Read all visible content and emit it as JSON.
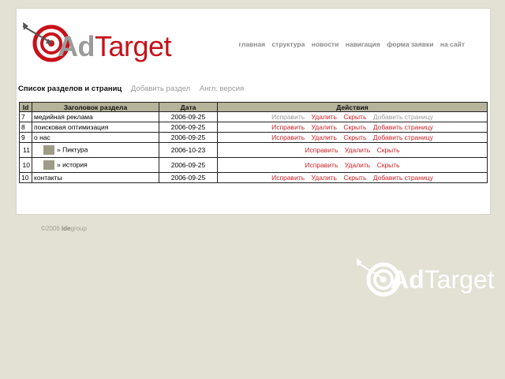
{
  "brand": {
    "ad": "Ad",
    "target": "Target"
  },
  "top_nav": [
    "главная",
    "структура",
    "новости",
    "навигация",
    "форма заявки",
    "на сайт"
  ],
  "sub_nav": {
    "active": "Список разделов и страниц",
    "add_section": "Добавить раздел",
    "english": "Англ. версия"
  },
  "table": {
    "headers": [
      "Id",
      "Заголовок раздела",
      "Дата",
      "Действия"
    ],
    "rows": [
      {
        "id": "7",
        "title": "медийная реклама",
        "date": "2006-09-25"
      },
      {
        "id": "8",
        "title": "поисковая оптимизация",
        "date": "2006-09-25"
      },
      {
        "id": "9",
        "title": "о нас",
        "date": "2006-09-25"
      },
      {
        "id": "11",
        "title": "» Пиктура",
        "date": "2006-10-23"
      },
      {
        "id": "10",
        "title": "» история",
        "date": "2006-09-25"
      },
      {
        "id": "10",
        "title": "контакты",
        "date": "2006-09-25"
      }
    ],
    "actions": {
      "edit": "Исправить",
      "delete": "Удалить",
      "hide": "Скрыть",
      "add_page": "Добавить страницу"
    }
  },
  "footer": {
    "copyright": "©2006 ",
    "company_bold": "ide",
    "company_rest": "group"
  },
  "colors": {
    "accent": "#c8101a",
    "header_bg": "#b5b39a",
    "page_bg": "#e3e1d4"
  }
}
